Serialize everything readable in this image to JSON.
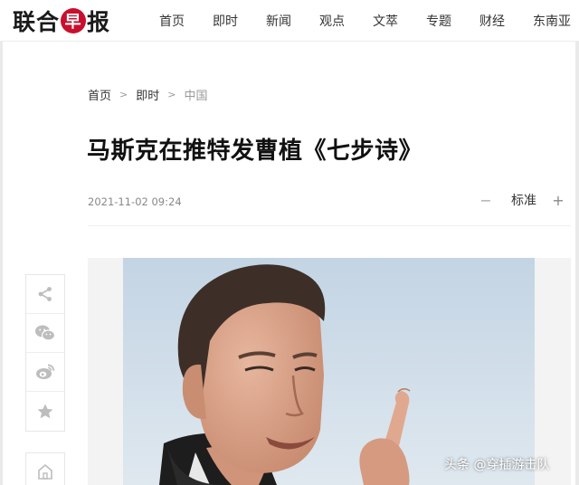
{
  "site": {
    "logo_text": "联合早报"
  },
  "nav": {
    "items": [
      "首页",
      "即时",
      "新闻",
      "观点",
      "文萃",
      "专题",
      "财经",
      "东南亚"
    ]
  },
  "breadcrumb": {
    "home": "首页",
    "section": "即时",
    "current": "中国",
    "separator": ">"
  },
  "article": {
    "title": "马斯克在推特发曹植《七步诗》",
    "timestamp": "2021-11-02 09:24",
    "font_size": {
      "decrease": "−",
      "label": "标准",
      "increase": "+"
    }
  },
  "share_rail": {
    "icons": [
      "share-icon",
      "wechat-icon",
      "weibo-icon",
      "bookmark-star-icon"
    ],
    "home_icon": "home-icon"
  },
  "watermark": {
    "text": "头条 @穿插游击队"
  },
  "colors": {
    "brand_red": "#c8102e",
    "text": "#222222",
    "muted": "#888888",
    "photo_sky": "#c8d7e6"
  }
}
